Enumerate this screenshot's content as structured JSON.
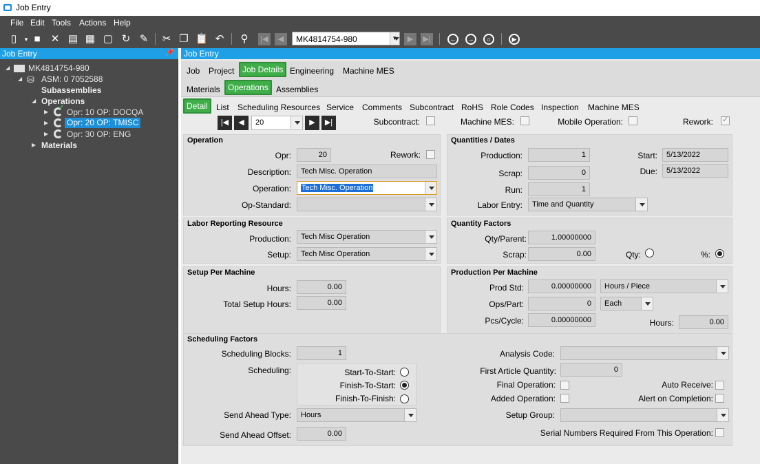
{
  "window": {
    "title": "Job Entry"
  },
  "menu": [
    "File",
    "Edit",
    "Tools",
    "Actions",
    "Help"
  ],
  "toolbar": {
    "job_number": "MK4814754-980"
  },
  "left_panel": {
    "header": "Job Entry",
    "tree": {
      "job": "MK4814754-980",
      "asm": "ASM: 0 7052588",
      "subassemblies": "Subassemblies",
      "operations": "Operations",
      "ops": [
        "Opr: 10 OP: DOCQA",
        "Opr: 20 OP: TMISC",
        "Opr: 30 OP: ENG"
      ],
      "materials": "Materials"
    }
  },
  "right_panel": {
    "header": "Job Entry",
    "tabs_1": [
      "Job",
      "Project",
      "Job Details",
      "Engineering",
      "Machine MES"
    ],
    "tabs_2": [
      "Materials",
      "Operations",
      "Assemblies"
    ],
    "tabs_3": [
      "Detail",
      "List",
      "Scheduling Resources",
      "Service",
      "Comments",
      "Subcontract",
      "RoHS",
      "Role Codes",
      "Inspection",
      "Machine MES"
    ],
    "nav_value": "20",
    "top_flags": {
      "subcontract": "Subcontract:",
      "machine_mes": "Machine MES:",
      "mobile_operation": "Mobile Operation:",
      "rework": "Rework:"
    }
  },
  "operation": {
    "title": "Operation",
    "opr_label": "Opr:",
    "opr": "20",
    "rework_label": "Rework:",
    "desc_label": "Description:",
    "desc": "Tech Misc. Operation",
    "operation_label": "Operation:",
    "operation": "Tech Misc. Operation",
    "opstd_label": "Op-Standard:",
    "opstd": ""
  },
  "quantities": {
    "title": "Quantities / Dates",
    "production_label": "Production:",
    "production": "1",
    "scrap_label": "Scrap:",
    "scrap": "0",
    "run_label": "Run:",
    "run": "1",
    "labor_entry_label": "Labor Entry:",
    "labor_entry": "Time and Quantity",
    "start_label": "Start:",
    "start": "5/13/2022",
    "due_label": "Due:",
    "due": "5/13/2022"
  },
  "labor_resource": {
    "title": "Labor Reporting Resource",
    "production_label": "Production:",
    "production": "Tech Misc Operation",
    "setup_label": "Setup:",
    "setup": "Tech Misc Operation"
  },
  "qty_factors": {
    "title": "Quantity Factors",
    "qty_parent_label": "Qty/Parent:",
    "qty_parent": "1.00000000",
    "scrap_label": "Scrap:",
    "scrap": "0.00",
    "qty_label": "Qty:",
    "pct_label": "%:"
  },
  "setup_machine": {
    "title": "Setup Per Machine",
    "hours_label": "Hours:",
    "hours": "0.00",
    "total_label": "Total Setup Hours:",
    "total": "0.00"
  },
  "prod_machine": {
    "title": "Production Per Machine",
    "prod_std_label": "Prod Std:",
    "prod_std": "0.00000000",
    "prod_std_unit": "Hours / Piece",
    "ops_part_label": "Ops/Part:",
    "ops_part": "0",
    "ops_part_unit": "Each",
    "pcs_cycle_label": "Pcs/Cycle:",
    "pcs_cycle": "0.00000000",
    "hours_label": "Hours:",
    "hours": "0.00"
  },
  "scheduling": {
    "title": "Scheduling Factors",
    "blocks_label": "Scheduling Blocks:",
    "blocks": "1",
    "scheduling_label": "Scheduling:",
    "sts": "Start-To-Start:",
    "fts": "Finish-To-Start:",
    "ftf": "Finish-To-Finish:",
    "send_ahead_type_label": "Send Ahead Type:",
    "send_ahead_type": "Hours",
    "send_ahead_offset_label": "Send Ahead Offset:",
    "send_ahead_offset": "0.00",
    "analysis_label": "Analysis Code:",
    "analysis": "",
    "fa_qty_label": "First Article Quantity:",
    "fa_qty": "0",
    "final_op_label": "Final Operation:",
    "added_op_label": "Added Operation:",
    "auto_receive_label": "Auto Receive:",
    "alert_label": "Alert on Completion:",
    "setup_group_label": "Setup Group:",
    "setup_group": "",
    "serial_label": "Serial Numbers Required From This Operation:"
  }
}
